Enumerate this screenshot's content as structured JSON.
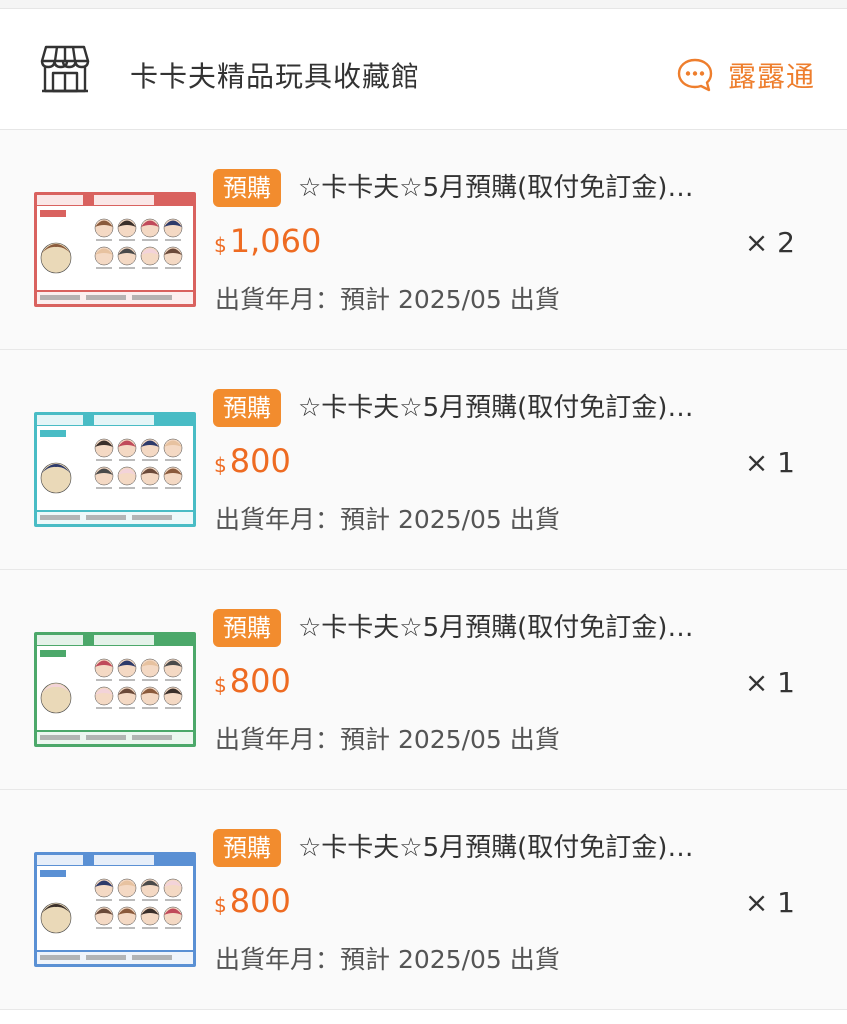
{
  "shop": {
    "name": "卡卡夫精品玩具收藏館",
    "chat_label": "露露通",
    "accent": "#ee7e2d"
  },
  "items": [
    {
      "tag": "預購",
      "title": "☆卡卡夫☆5月預購(取付免訂金)…",
      "currency": "$",
      "price": "1,060",
      "qty": "× 2",
      "ship": "出貨年月：預計 2025/05 出貨",
      "thumb_color": "#d9625f"
    },
    {
      "tag": "預購",
      "title": "☆卡卡夫☆5月預購(取付免訂金)…",
      "currency": "$",
      "price": "800",
      "qty": "× 1",
      "ship": "出貨年月：預計 2025/05 出貨",
      "thumb_color": "#49bcc5"
    },
    {
      "tag": "預購",
      "title": "☆卡卡夫☆5月預購(取付免訂金)…",
      "currency": "$",
      "price": "800",
      "qty": "× 1",
      "ship": "出貨年月：預計 2025/05 出貨",
      "thumb_color": "#4ca86a"
    },
    {
      "tag": "預購",
      "title": "☆卡卡夫☆5月預購(取付免訂金)…",
      "currency": "$",
      "price": "800",
      "qty": "× 1",
      "ship": "出貨年月：預計 2025/05 出貨",
      "thumb_color": "#5a90d4"
    }
  ]
}
